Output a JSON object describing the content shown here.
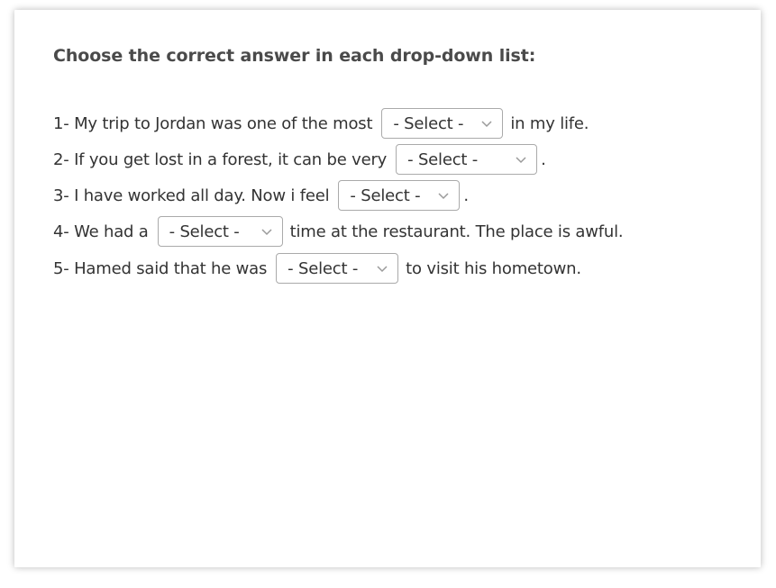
{
  "instruction": "Choose the correct answer in each drop-down list:",
  "questions": [
    {
      "before": "1- My trip to Jordan was one of the most",
      "select": "- Select -",
      "after": "in my life."
    },
    {
      "before": "2- If you get lost in a forest, it can be very",
      "select": "- Select -",
      "after": "."
    },
    {
      "before": "3- I have worked all day. Now i feel",
      "select": "- Select -",
      "after": "."
    },
    {
      "before": "4- We had a",
      "select": "- Select -",
      "after": "time at the restaurant. The place is awful."
    },
    {
      "before": "5- Hamed said that he was",
      "select": "- Select -",
      "after": "to visit his hometown."
    }
  ],
  "icons": {
    "dropdown": "chevron-down-icon"
  },
  "colors": {
    "text": "#333333",
    "heading": "#4a4a4a",
    "border": "#aaaaaa",
    "chevron": "#9a9a9a"
  }
}
